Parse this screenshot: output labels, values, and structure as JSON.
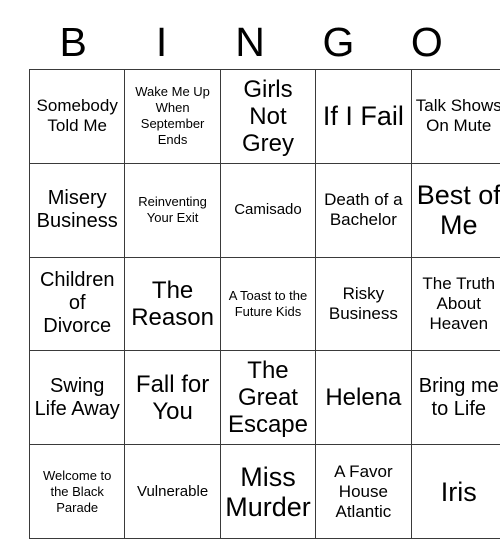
{
  "card": {
    "header_letters": [
      "B",
      "I",
      "N",
      "G",
      "O"
    ],
    "rows": [
      [
        {
          "label": "Somebody Told Me",
          "size": "md"
        },
        {
          "label": "Wake Me Up When September Ends",
          "size": "xs"
        },
        {
          "label": "Girls Not Grey",
          "size": "xl"
        },
        {
          "label": "If I Fail",
          "size": "xxl"
        },
        {
          "label": "Talk Shows On Mute",
          "size": "md"
        }
      ],
      [
        {
          "label": "Misery Business",
          "size": "lg"
        },
        {
          "label": "Reinventing Your Exit",
          "size": "xs"
        },
        {
          "label": "Camisado",
          "size": "sm"
        },
        {
          "label": "Death of a Bachelor",
          "size": "md"
        },
        {
          "label": "Best of Me",
          "size": "xxl"
        }
      ],
      [
        {
          "label": "Children of Divorce",
          "size": "lg"
        },
        {
          "label": "The Reason",
          "size": "xl"
        },
        {
          "label": "A Toast to the Future Kids",
          "size": "xs"
        },
        {
          "label": "Risky Business",
          "size": "md"
        },
        {
          "label": "The Truth About Heaven",
          "size": "md"
        }
      ],
      [
        {
          "label": "Swing Life Away",
          "size": "lg"
        },
        {
          "label": "Fall for You",
          "size": "xl"
        },
        {
          "label": "The Great Escape",
          "size": "xl"
        },
        {
          "label": "Helena",
          "size": "xl"
        },
        {
          "label": "Bring me to Life",
          "size": "lg"
        }
      ],
      [
        {
          "label": "Welcome to the Black Parade",
          "size": "xs"
        },
        {
          "label": "Vulnerable",
          "size": "sm"
        },
        {
          "label": "Miss Murder",
          "size": "xxl"
        },
        {
          "label": "A Favor House Atlantic",
          "size": "md"
        },
        {
          "label": "Iris",
          "size": "xxl"
        }
      ]
    ]
  },
  "colors": {
    "background": "#ffffff",
    "text": "#000000",
    "border": "#3a3a3a"
  }
}
